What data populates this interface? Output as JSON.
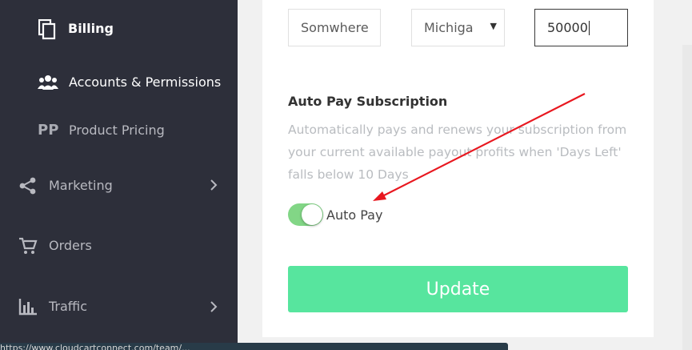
{
  "sidebar": {
    "items": [
      {
        "label": "Billing",
        "icon": "copy-icon"
      },
      {
        "label": "Accounts & Permissions",
        "icon": "users-icon"
      },
      {
        "icon_text": "PP",
        "label": "Product Pricing",
        "icon": "pp-text-icon"
      },
      {
        "label": "Marketing",
        "icon": "share-icon"
      },
      {
        "label": "Orders",
        "icon": "cart-icon"
      },
      {
        "label": "Traffic",
        "icon": "bar-chart-icon"
      }
    ]
  },
  "address": {
    "city_value": "Somwhere",
    "state_value": "Michiga",
    "zip_value": "50000"
  },
  "autopay": {
    "title": "Auto Pay Subscription",
    "description": "Automatically pays and renews your subscription from your current available payout profits when 'Days Left' falls below 10 Days",
    "toggle_label": "Auto Pay",
    "enabled": true
  },
  "update_button_label": "Update",
  "status_bar_text": "https://www.cloudcartconnect.com/team/...",
  "colors": {
    "sidebar_bg": "#2d2f3a",
    "toggle_on": "#82d686",
    "update_button": "#57e59e",
    "annotation_arrow": "#e8171f"
  }
}
